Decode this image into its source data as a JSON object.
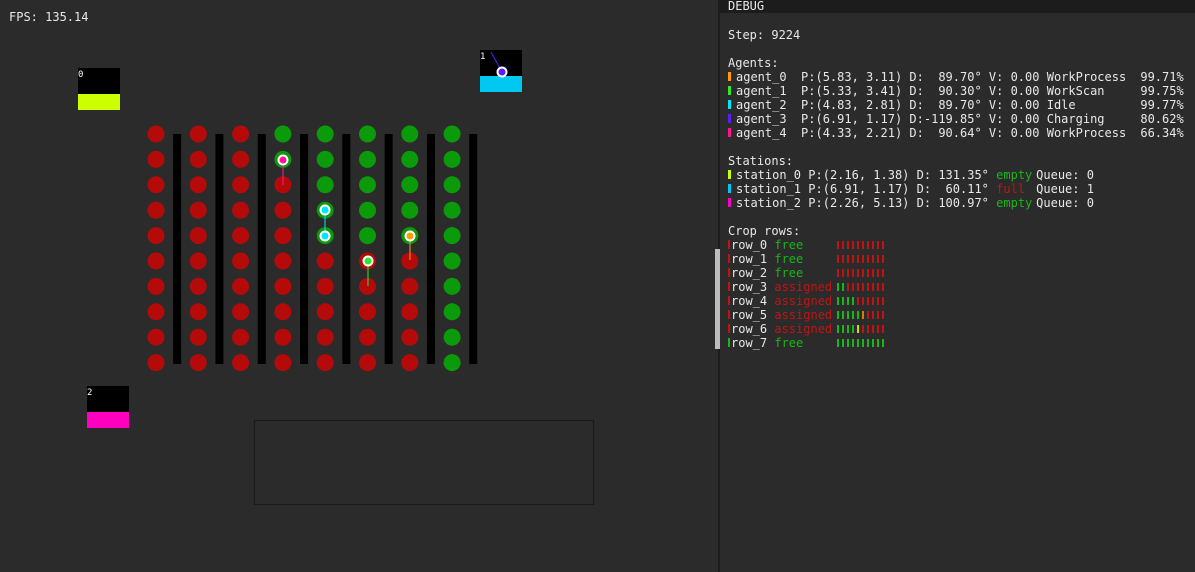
{
  "fps_text": "FPS: 135.14",
  "panel_title": "DEBUG",
  "step_text": "Step: 9224",
  "agents_header": "Agents:",
  "agents": [
    {
      "name": "agent_0",
      "pos": "P:(5.83, 3.11)",
      "dir": "D:  89.70°",
      "vel": "V: 0.00",
      "state": "WorkProcess",
      "battery": "99.71%",
      "color": "#ff9a00"
    },
    {
      "name": "agent_1",
      "pos": "P:(5.33, 3.41)",
      "dir": "D:  90.30°",
      "vel": "V: 0.00",
      "state": "WorkScan",
      "battery": "99.75%",
      "color": "#2ee82e"
    },
    {
      "name": "agent_2",
      "pos": "P:(4.83, 2.81)",
      "dir": "D:  89.70°",
      "vel": "V: 0.00",
      "state": "Idle",
      "battery": "99.77%",
      "color": "#00e5ff"
    },
    {
      "name": "agent_3",
      "pos": "P:(6.91, 1.17)",
      "dir": "D:-119.85°",
      "vel": "V: 0.00",
      "state": "Charging",
      "battery": "80.62%",
      "color": "#5a1bff"
    },
    {
      "name": "agent_4",
      "pos": "P:(4.33, 2.21)",
      "dir": "D:  90.64°",
      "vel": "V: 0.00",
      "state": "WorkProcess",
      "battery": "66.34%",
      "color": "#ff1493"
    }
  ],
  "stations_header": "Stations:",
  "stations": [
    {
      "id": "0",
      "name": "station_0",
      "pos": "P:(2.16, 1.38)",
      "dir": "D: 131.35°",
      "status": "empty",
      "queue": "Queue: 0",
      "color": "#ccff00"
    },
    {
      "id": "1",
      "name": "station_1",
      "pos": "P:(6.91, 1.17)",
      "dir": "D:  60.11°",
      "status": "full",
      "queue": "Queue: 1",
      "color": "#00c8f0"
    },
    {
      "id": "2",
      "name": "station_2",
      "pos": "P:(2.26, 5.13)",
      "dir": "D: 100.97°",
      "status": "empty",
      "queue": "Queue: 0",
      "color": "#ff00c0"
    }
  ],
  "crop_rows_header": "Crop rows:",
  "crop_rows": [
    {
      "name": "row_0",
      "status": "free",
      "progress": "0000000000"
    },
    {
      "name": "row_1",
      "status": "free",
      "progress": "0000000000"
    },
    {
      "name": "row_2",
      "status": "free",
      "progress": "0000000000"
    },
    {
      "name": "row_3",
      "status": "assigned",
      "progress": "2200000000"
    },
    {
      "name": "row_4",
      "status": "assigned",
      "progress": "2222000000"
    },
    {
      "name": "row_5",
      "status": "assigned",
      "progress": "2222210000"
    },
    {
      "name": "row_6",
      "status": "assigned",
      "progress": "2222300000"
    },
    {
      "name": "row_7",
      "status": "free",
      "progress": "2222222222"
    }
  ],
  "field_plants": [
    "RRRGGGGG",
    "RRRGGGGG",
    "RRRRGGGG",
    "RRRRGGGG",
    "RRRRGGGG",
    "RRRRRRRG",
    "RRRRRRRG",
    "RRRRRRRG",
    "RRRRRRRG",
    "RRRRRRRG"
  ],
  "colors": {
    "plant_red": "#b40a0a",
    "plant_green": "#0a9a0a",
    "free": "#1ab51a",
    "busy": "#c01414",
    "tick_orange": "#e07800",
    "tick_yellow": "#c8e000"
  }
}
